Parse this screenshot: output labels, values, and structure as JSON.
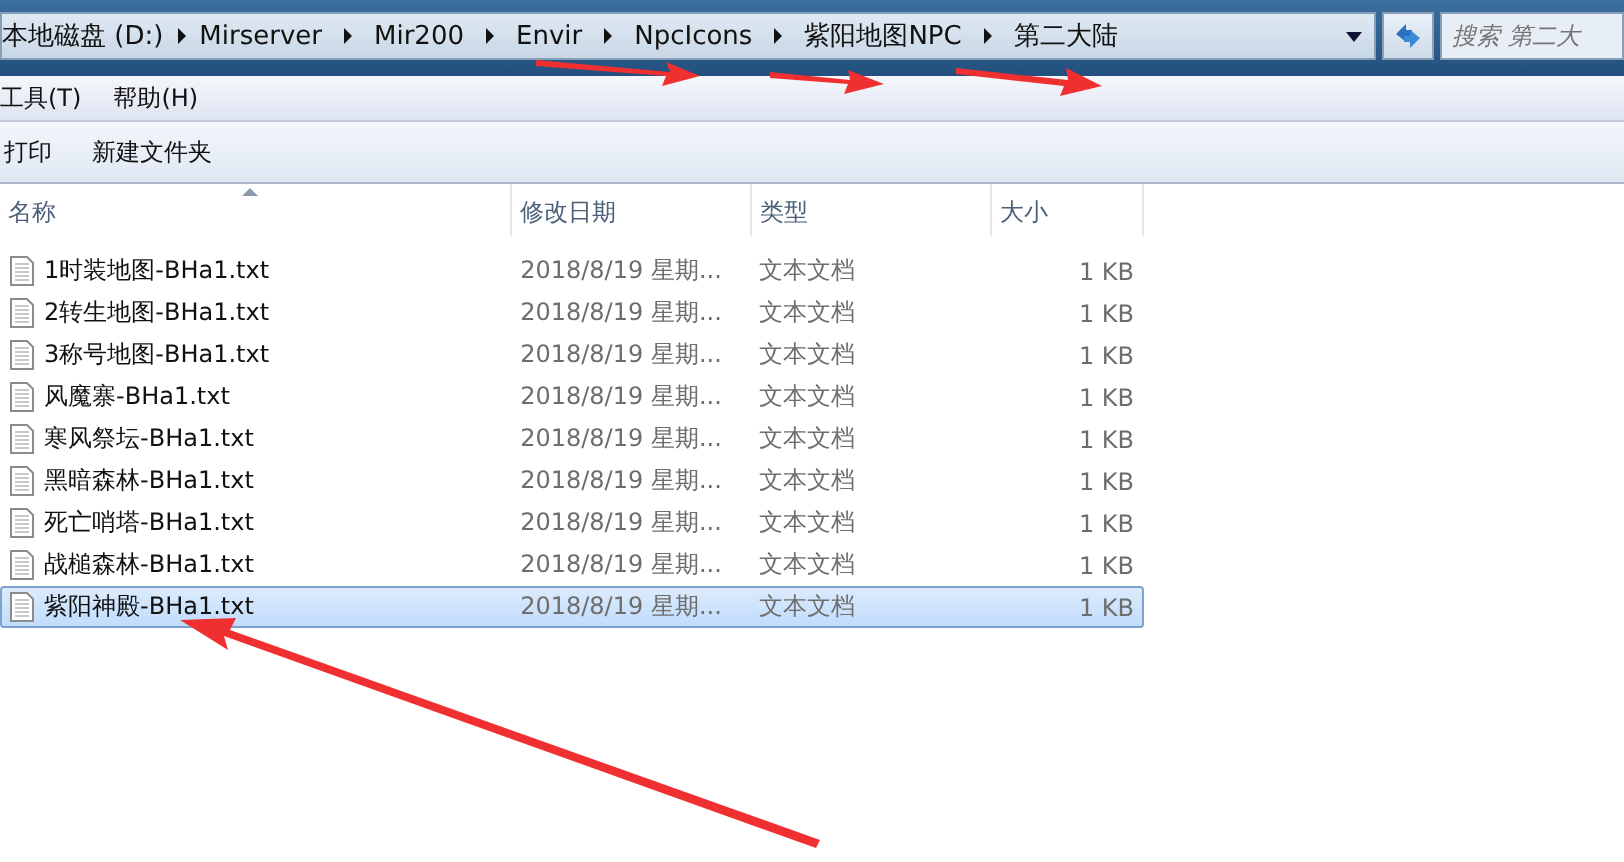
{
  "address_bar": {
    "segments": [
      "本地磁盘 (D:)",
      "Mirserver",
      "Mir200",
      "Envir",
      "NpcIcons",
      "紫阳地图NPC",
      "第二大陆"
    ]
  },
  "search": {
    "placeholder": "搜索 第二大"
  },
  "menu": [
    "工具(T)",
    "帮助(H)"
  ],
  "toolbar": [
    "打印",
    "新建文件夹"
  ],
  "table": {
    "columns": [
      "名称",
      "修改日期",
      "类型",
      "大小"
    ],
    "rows": [
      {
        "name": "1时装地图-BHa1.txt",
        "date": "2018/8/19 星期...",
        "type": "文本文档",
        "size": "1 KB",
        "selected": false
      },
      {
        "name": "2转生地图-BHa1.txt",
        "date": "2018/8/19 星期...",
        "type": "文本文档",
        "size": "1 KB",
        "selected": false
      },
      {
        "name": "3称号地图-BHa1.txt",
        "date": "2018/8/19 星期...",
        "type": "文本文档",
        "size": "1 KB",
        "selected": false
      },
      {
        "name": "风魔寨-BHa1.txt",
        "date": "2018/8/19 星期...",
        "type": "文本文档",
        "size": "1 KB",
        "selected": false
      },
      {
        "name": "寒风祭坛-BHa1.txt",
        "date": "2018/8/19 星期...",
        "type": "文本文档",
        "size": "1 KB",
        "selected": false
      },
      {
        "name": "黑暗森林-BHa1.txt",
        "date": "2018/8/19 星期...",
        "type": "文本文档",
        "size": "1 KB",
        "selected": false
      },
      {
        "name": "死亡哨塔-BHa1.txt",
        "date": "2018/8/19 星期...",
        "type": "文本文档",
        "size": "1 KB",
        "selected": false
      },
      {
        "name": "战槌森林-BHa1.txt",
        "date": "2018/8/19 星期...",
        "type": "文本文档",
        "size": "1 KB",
        "selected": false
      },
      {
        "name": "紫阳神殿-BHa1.txt",
        "date": "2018/8/19 星期...",
        "type": "文本文档",
        "size": "1 KB",
        "selected": true
      }
    ]
  }
}
